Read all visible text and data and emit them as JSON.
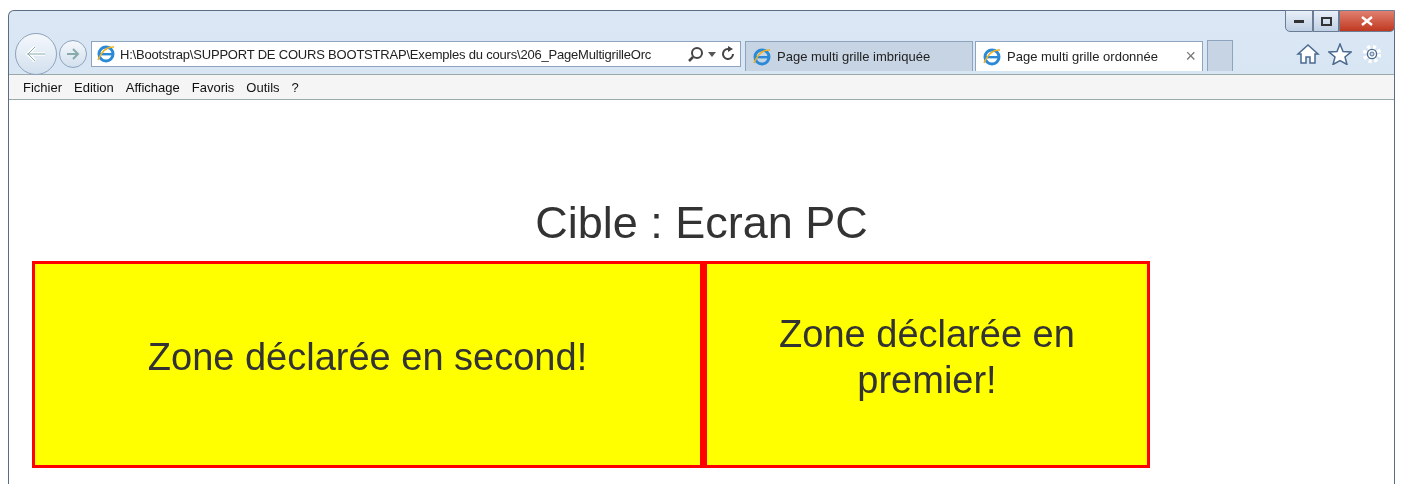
{
  "address_bar": {
    "value": "H:\\Bootstrap\\SUPPORT DE COURS BOOTSTRAP\\Exemples du cours\\206_PageMultigrilleOrc"
  },
  "tabs": [
    {
      "label": "Page multi grille imbriquée",
      "selected": false
    },
    {
      "label": "Page multi grille ordonnée",
      "selected": true,
      "close": "×"
    }
  ],
  "menu": [
    "Fichier",
    "Edition",
    "Affichage",
    "Favoris",
    "Outils",
    "?"
  ],
  "page": {
    "heading": "Cible : Ecran PC",
    "zones": [
      {
        "text": "Zone déclarée en second!"
      },
      {
        "text": "Zone déclarée en premier!"
      }
    ]
  }
}
